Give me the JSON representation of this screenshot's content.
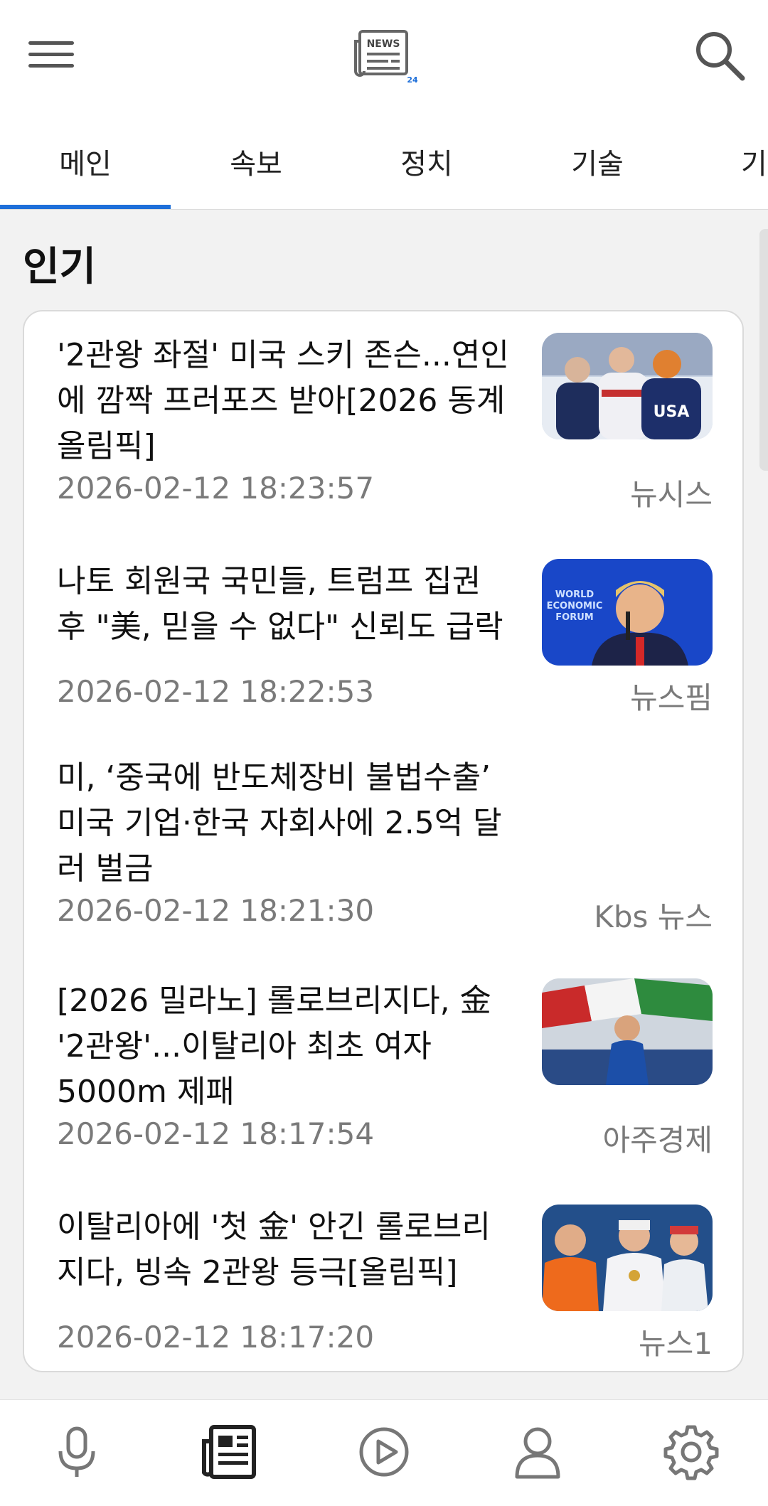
{
  "app": {
    "logo_text": "NEWS",
    "logo_badge": "24"
  },
  "tabs": [
    {
      "label": "메인",
      "active": true
    },
    {
      "label": "속보",
      "active": false
    },
    {
      "label": "정치",
      "active": false
    },
    {
      "label": "기술",
      "active": false
    },
    {
      "label": "기",
      "active": false
    }
  ],
  "section": {
    "title": "인기"
  },
  "articles": [
    {
      "title": "'2관왕 좌절' 미국 스키 존슨...연인에 깜짝 프러포즈 받아[2026 동계올림픽]",
      "time": "2026-02-12 18:23:57",
      "source": "뉴시스",
      "thumb_badge": "USA"
    },
    {
      "title": "나토 회원국 국민들, 트럼프 집권 후 \"美, 믿을 수 없다\" 신뢰도 급락",
      "time": "2026-02-12 18:22:53",
      "source": "뉴스핌",
      "thumb_badge": "WORLD ECONOMIC FORUM"
    },
    {
      "title": "미, ‘중국에 반도체장비 불법수출’ 미국 기업·한국 자회사에 2.5억 달러 벌금",
      "time": "2026-02-12 18:21:30",
      "source": "Kbs 뉴스"
    },
    {
      "title": "[2026 밀라노] 롤로브리지다, 金 '2관왕'...이탈리아 최초 여자 5000m 제패",
      "time": "2026-02-12 18:17:54",
      "source": "아주경제"
    },
    {
      "title": "이탈리아에 '첫 金' 안긴 롤로브리지다, 빙속 2관왕 등극[올림픽]",
      "time": "2026-02-12 18:17:20",
      "source": "뉴스1"
    }
  ],
  "bottom_nav": [
    {
      "icon": "microphone-icon"
    },
    {
      "icon": "newspaper-icon",
      "active": true
    },
    {
      "icon": "play-icon"
    },
    {
      "icon": "person-icon"
    },
    {
      "icon": "gear-icon"
    }
  ],
  "colors": {
    "accent": "#1e6fd9",
    "text_secondary": "#7a7a7a"
  }
}
